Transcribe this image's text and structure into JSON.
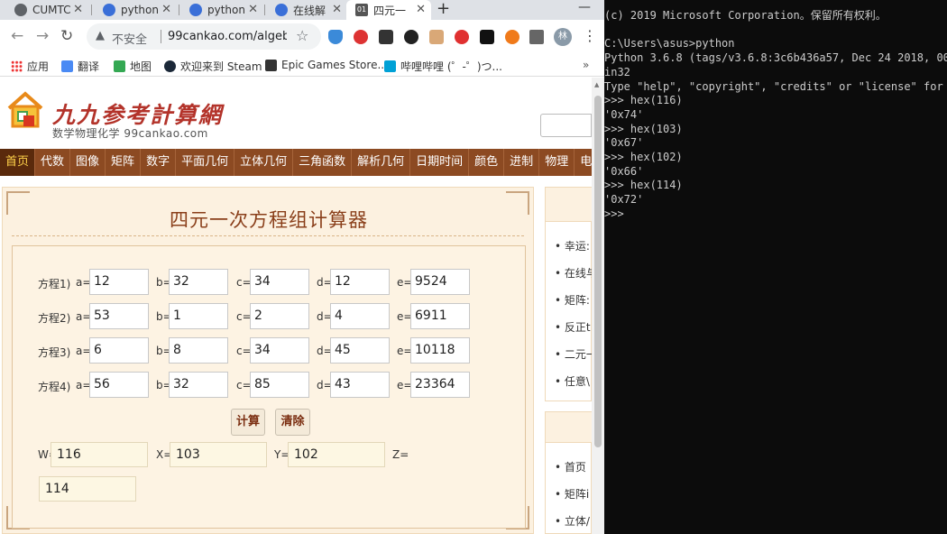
{
  "browser": {
    "tabs": [
      {
        "title": "CUMTC",
        "color": "#5f6368"
      },
      {
        "title": "python",
        "color": "#3a6fd8"
      },
      {
        "title": "python",
        "color": "#3a6fd8"
      },
      {
        "title": "在线解",
        "color": "#3a6fd8"
      },
      {
        "title": "四元一",
        "color": "#555555",
        "badge": "01"
      }
    ],
    "new_tab": "+",
    "minimize": "—",
    "insecure_label": "不安全",
    "url": "99cankao.com/algebr...",
    "avatar_text": "林"
  },
  "bookmarks": [
    {
      "label": "应用",
      "color": "#e33"
    },
    {
      "label": "翻译",
      "color": "#4a8af4"
    },
    {
      "label": "地图",
      "color": "#34a853"
    },
    {
      "label": "欢迎来到 Steam",
      "color": "#1b2838"
    },
    {
      "label": "Epic Games Store...",
      "color": "#333333"
    },
    {
      "label": "哔哩哔哩 (゜-゜)つ...",
      "color": "#00a1d6"
    }
  ],
  "site": {
    "logo_title": "九九参考計算網",
    "logo_sub": "数学物理化学",
    "logo_domain": "99cankao.com",
    "nav": [
      "首页",
      "代数",
      "图像",
      "矩阵",
      "数字",
      "平面几何",
      "立体几何",
      "三角函数",
      "解析几何",
      "日期时间",
      "颜色",
      "进制",
      "物理",
      "电子"
    ],
    "calc_title": "四元一次方程组计算器",
    "equations": [
      {
        "label": "方程1)",
        "a": "12",
        "b": "32",
        "c": "34",
        "d": "12",
        "e": "9524"
      },
      {
        "label": "方程2)",
        "a": "53",
        "b": "1",
        "c": "2",
        "d": "4",
        "e": "6911"
      },
      {
        "label": "方程3)",
        "a": "6",
        "b": "8",
        "c": "34",
        "d": "45",
        "e": "10118"
      },
      {
        "label": "方程4)",
        "a": "56",
        "b": "32",
        "c": "85",
        "d": "43",
        "e": "23364"
      }
    ],
    "coef_labels": {
      "a": "a=",
      "b": "b=",
      "c": "c=",
      "d": "d=",
      "e": "e="
    },
    "calc_button": "计算",
    "clear_button": "清除",
    "results": {
      "w_label": "W=",
      "w": "116",
      "x_label": "X=",
      "x": "103",
      "y_label": "Y=",
      "y": "102",
      "z_label": "Z=",
      "z": "114"
    },
    "side1_links": [
      "• 幸运:",
      "• 在线与",
      "• 矩阵:",
      "• 反正t",
      "• 二元一",
      "• 任意\\"
    ],
    "side2_links": [
      "• 首页",
      "• 矩阵i",
      "• 立体/"
    ]
  },
  "console": {
    "lines": [
      "(c) 2019 Microsoft Corporation。保留所有权利。",
      "",
      "C:\\Users\\asus>python",
      "Python 3.6.8 (tags/v3.6.8:3c6b436a57, Dec 24 2018, 00:1",
      "in32",
      "Type \"help\", \"copyright\", \"credits\" or \"license\" for mo",
      ">>> hex(116)",
      "'0x74'",
      ">>> hex(103)",
      "'0x67'",
      ">>> hex(102)",
      "'0x66'",
      ">>> hex(114)",
      "'0x72'",
      ">>>"
    ]
  },
  "colors": {
    "nav_bg": "#8c4a22",
    "nav_home_bg": "#5a2a0c",
    "nav_home_text": "#ffd24a",
    "panel_bg": "#fcf1e0",
    "title_color": "#8a3f1a",
    "console_bg": "#0c0c0c",
    "console_text": "#cccccc"
  },
  "icons": {
    "back": "arrow-left-icon",
    "forward": "arrow-right-icon",
    "reload": "reload-icon",
    "warning": "warning-icon",
    "star": "star-icon",
    "menu": "kebab-menu-icon"
  }
}
